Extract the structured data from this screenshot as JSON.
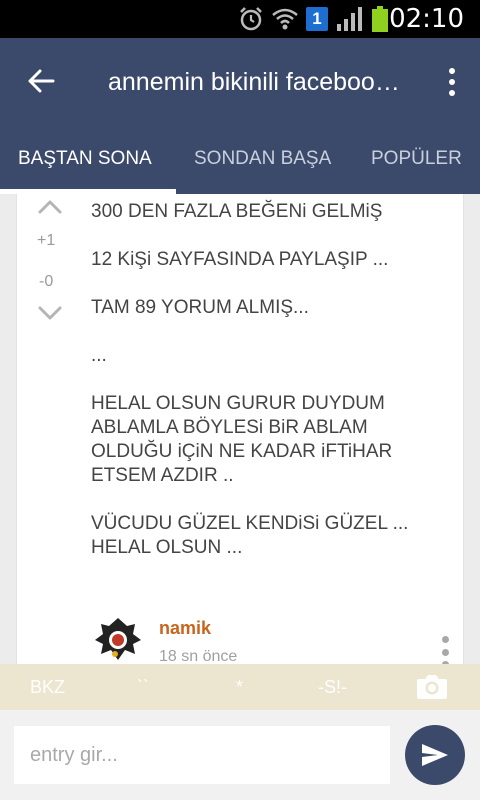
{
  "status_bar": {
    "time": "02:10",
    "notification_count": "1",
    "icons": [
      "alarm-icon",
      "wifi-icon",
      "signal-icon",
      "battery-icon"
    ],
    "battery_color": "#8fd11e"
  },
  "app_bar": {
    "title": "annemin bikinili facebook fotoğrafı",
    "back_icon": "arrow-left-icon",
    "menu_icon": "overflow-menu-icon",
    "color": "#3b4a6b"
  },
  "tabs": [
    {
      "label": "BAŞTAN SONA",
      "active": true
    },
    {
      "label": "SONDAN BAŞA",
      "active": false
    },
    {
      "label": "POPÜLER",
      "active": false
    }
  ],
  "entry": {
    "vote_up": "+1",
    "vote_down": "-0",
    "paragraphs": [
      "300 DEN FAZLA BEĞENi GELMiŞ",
      "12 KiŞi SAYFASINDA PAYLAŞIP ...",
      "TAM 89 YORUM ALMIŞ...",
      "...",
      "HELAL OLSUN GURUR DUYDUM ABLAMLA BÖYLESi BiR ABLAM OLDUĞU iÇiN NE KADAR iFTiHAR ETSEM AZDIR ..",
      "VÜCUDU GÜZEL KENDiSi GÜZEL ... HELAL OLSUN ..."
    ],
    "author": "namik",
    "time": "18 sn önce",
    "author_color": "#c8641e"
  },
  "format_bar": {
    "bkz": "BKZ",
    "backtick": "``",
    "star": "*",
    "spoiler": "-S!-",
    "camera_icon": "camera-icon"
  },
  "input": {
    "placeholder": "entry gir...",
    "value": "",
    "send_icon": "send-icon"
  }
}
